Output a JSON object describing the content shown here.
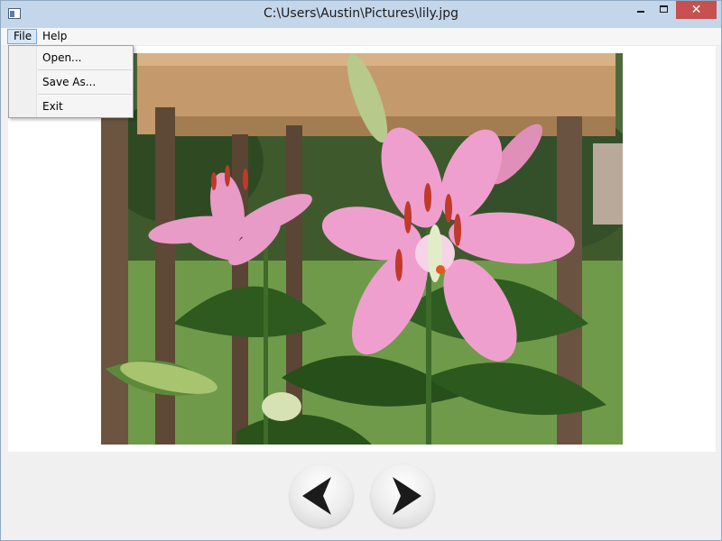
{
  "window": {
    "title": "C:\\Users\\Austin\\Pictures\\lily.jpg",
    "close_glyph": "✕",
    "controls": [
      "minimize-icon",
      "maximize-icon",
      "close-icon"
    ]
  },
  "menubar": {
    "items": [
      {
        "label": "File",
        "active": true
      },
      {
        "label": "Help",
        "active": false
      }
    ]
  },
  "file_menu": {
    "items": [
      {
        "label": "Open..."
      },
      {
        "label": "Save As..."
      },
      {
        "label": "Exit"
      }
    ]
  },
  "viewer": {
    "image_subject": "pink lily flowers on a wooden deck"
  },
  "navigation": {
    "buttons": [
      {
        "icon": "arrow-left-icon"
      },
      {
        "icon": "arrow-right-icon"
      }
    ]
  },
  "colors": {
    "titlebar": "#c4d6ea",
    "close_button": "#c75050",
    "menu_highlight": "#d5e7f7"
  }
}
